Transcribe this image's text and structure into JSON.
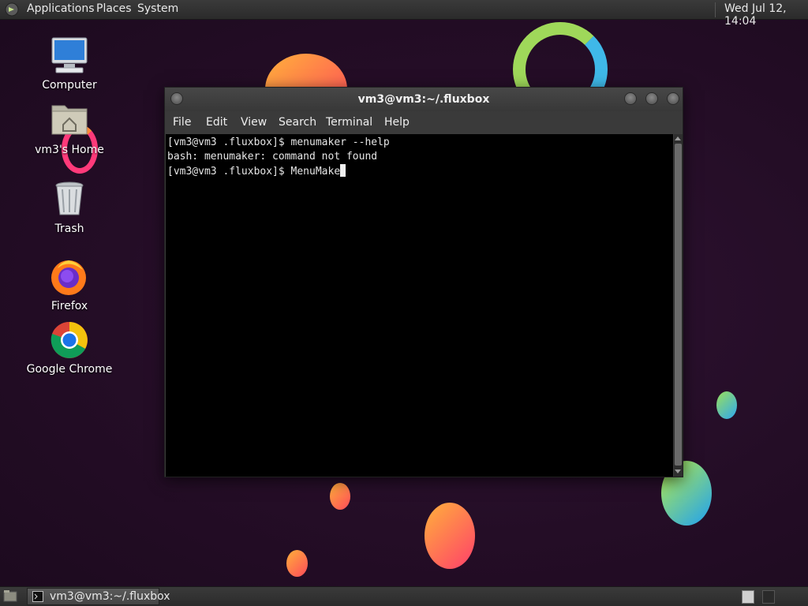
{
  "top_panel": {
    "menus": [
      "Applications",
      "Places",
      "System"
    ],
    "clock": "Wed Jul 12, 14:04"
  },
  "desktop": {
    "icons": [
      {
        "label": "Computer",
        "icon": "computer-icon"
      },
      {
        "label": "vm3's Home",
        "icon": "home-folder-icon"
      },
      {
        "label": "Trash",
        "icon": "trash-icon"
      },
      {
        "label": "Firefox",
        "icon": "firefox-icon"
      },
      {
        "label": "Google Chrome",
        "icon": "chrome-icon"
      }
    ]
  },
  "terminal_window": {
    "title": "vm3@vm3:~/.fluxbox",
    "menu": [
      "File",
      "Edit",
      "View",
      "Search",
      "Terminal",
      "Help"
    ],
    "lines": [
      "[vm3@vm3 .fluxbox]$ menumaker --help",
      "bash: menumaker: command not found",
      "[vm3@vm3 .fluxbox]$ MenuMake"
    ]
  },
  "bottom_panel": {
    "task_label": "vm3@vm3:~/.fluxbox"
  },
  "colors": {
    "background": "#240d26",
    "panel": "#333333",
    "terminal_bg": "#000000",
    "terminal_fg": "#e6e6e6"
  }
}
